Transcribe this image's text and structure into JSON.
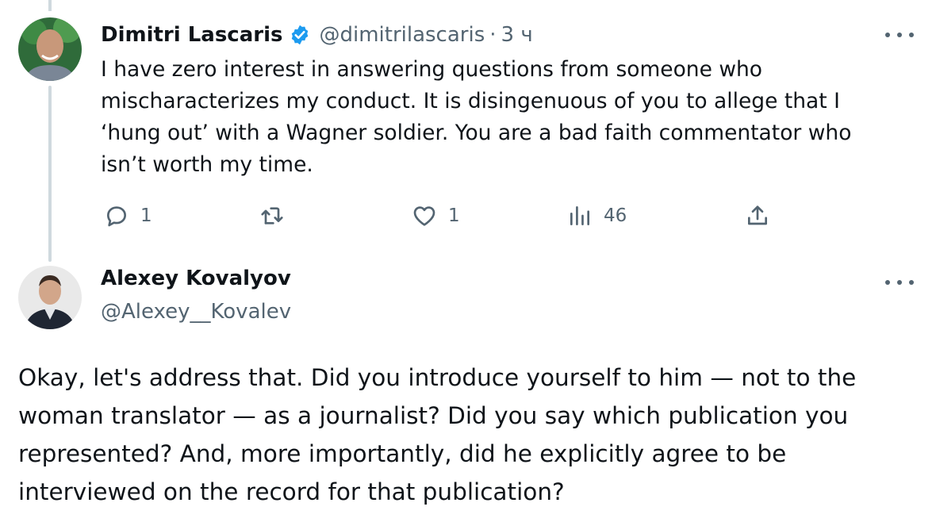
{
  "reply_tweet": {
    "author": {
      "name": "Dimitri Lascaris",
      "handle": "@dimitrilascaris",
      "verified": true,
      "avatar": "avatar-photo"
    },
    "separator": "·",
    "time": "3 ч",
    "text": "I have zero interest in answering questions from someone who mischaracterizes my conduct. It is disingenuous of you to allege that I ‘hung out’ with a Wagner soldier. You are a bad faith commentator who isn’t worth my time.",
    "actions": {
      "reply": {
        "icon": "reply-icon",
        "count": "1"
      },
      "retweet": {
        "icon": "retweet-icon",
        "count": ""
      },
      "like": {
        "icon": "like-icon",
        "count": "1"
      },
      "views": {
        "icon": "views-icon",
        "count": "46"
      },
      "share": {
        "icon": "share-icon"
      }
    }
  },
  "main_tweet": {
    "author": {
      "name": "Alexey Kovalyov",
      "handle": "@Alexey__Kovalev",
      "avatar": "avatar-photo"
    },
    "text": "Okay, let's address that. Did you introduce yourself to him — not to the woman translator — as a journalist? Did you say which publication you represented? And, more importantly, did he explicitly agree to be interviewed on the record for that publication?"
  },
  "colors": {
    "text": "#0f1419",
    "secondary": "#536471",
    "verified": "#1d9bf0",
    "thread_line": "#cfd9de"
  }
}
